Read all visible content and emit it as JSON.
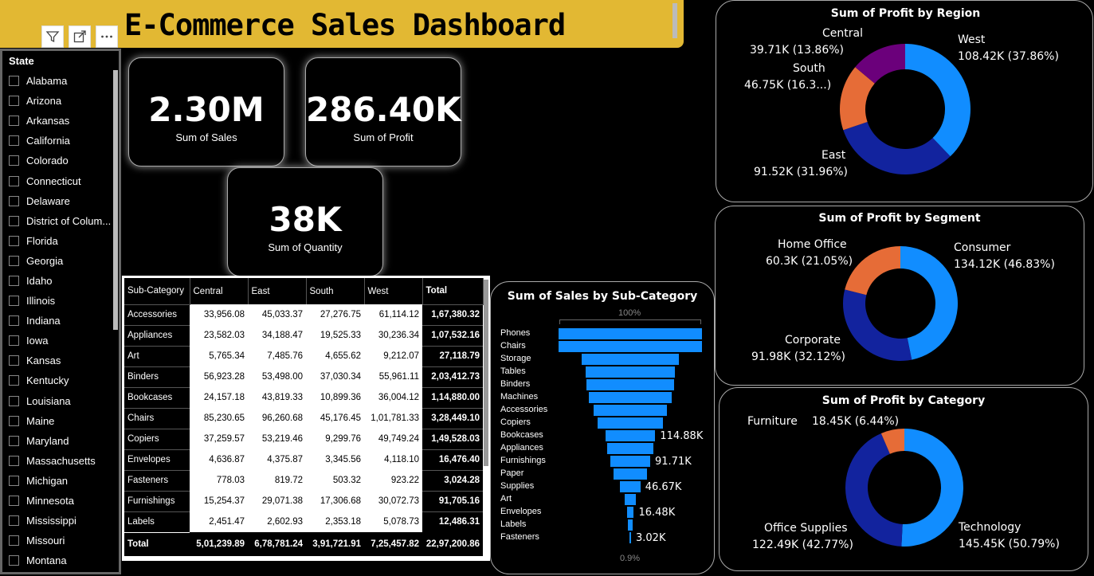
{
  "title": "E-Commerce Sales Dashboard",
  "header_icons": [
    "filter-icon",
    "expand-icon",
    "more-options-icon"
  ],
  "slicer": {
    "title": "State",
    "items": [
      "Alabama",
      "Arizona",
      "Arkansas",
      "California",
      "Colorado",
      "Connecticut",
      "Delaware",
      "District of Colum...",
      "Florida",
      "Georgia",
      "Idaho",
      "Illinois",
      "Indiana",
      "Iowa",
      "Kansas",
      "Kentucky",
      "Louisiana",
      "Maine",
      "Maryland",
      "Massachusetts",
      "Michigan",
      "Minnesota",
      "Mississippi",
      "Missouri",
      "Montana"
    ]
  },
  "kpis": {
    "sales": {
      "value": "2.30M",
      "label": "Sum of Sales"
    },
    "profit": {
      "value": "286.40K",
      "label": "Sum of Profit"
    },
    "quantity": {
      "value": "38K",
      "label": "Sum of Quantity"
    }
  },
  "matrix": {
    "headers": [
      "Sub-Category",
      "Central",
      "East",
      "South",
      "West",
      "Total"
    ],
    "rows": [
      [
        "Accessories",
        "33,956.08",
        "45,033.37",
        "27,276.75",
        "61,114.12",
        "1,67,380.32"
      ],
      [
        "Appliances",
        "23,582.03",
        "34,188.47",
        "19,525.33",
        "30,236.34",
        "1,07,532.16"
      ],
      [
        "Art",
        "5,765.34",
        "7,485.76",
        "4,655.62",
        "9,212.07",
        "27,118.79"
      ],
      [
        "Binders",
        "56,923.28",
        "53,498.00",
        "37,030.34",
        "55,961.11",
        "2,03,412.73"
      ],
      [
        "Bookcases",
        "24,157.18",
        "43,819.33",
        "10,899.36",
        "36,004.12",
        "1,14,880.00"
      ],
      [
        "Chairs",
        "85,230.65",
        "96,260.68",
        "45,176.45",
        "1,01,781.33",
        "3,28,449.10"
      ],
      [
        "Copiers",
        "37,259.57",
        "53,219.46",
        "9,299.76",
        "49,749.24",
        "1,49,528.03"
      ],
      [
        "Envelopes",
        "4,636.87",
        "4,375.87",
        "3,345.56",
        "4,118.10",
        "16,476.40"
      ],
      [
        "Fasteners",
        "778.03",
        "819.72",
        "503.32",
        "923.22",
        "3,024.28"
      ],
      [
        "Furnishings",
        "15,254.37",
        "29,071.38",
        "17,306.68",
        "30,072.73",
        "91,705.16"
      ],
      [
        "Labels",
        "2,451.47",
        "2,602.93",
        "2,353.18",
        "5,078.73",
        "12,486.31"
      ]
    ],
    "total": [
      "Total",
      "5,01,239.89",
      "6,78,781.24",
      "3,91,721.91",
      "7,25,457.82",
      "22,97,200.86"
    ]
  },
  "chart_data": [
    {
      "type": "pie",
      "title": "Sum of Profit by Region",
      "labels": [
        "West",
        "East",
        "South",
        "Central"
      ],
      "values": [
        108.42,
        91.52,
        46.75,
        39.71
      ],
      "percents": [
        37.86,
        31.96,
        16.3,
        13.86
      ],
      "value_labels": [
        "108.42K (37.86%)",
        "91.52K (31.96%)",
        "46.75K (16.3...)",
        "39.71K (13.86%)"
      ],
      "colors": [
        "#118dff",
        "#12239e",
        "#e66c37",
        "#6b007b"
      ]
    },
    {
      "type": "pie",
      "title": "Sum of Profit by Segment",
      "labels": [
        "Consumer",
        "Corporate",
        "Home Office"
      ],
      "values": [
        134.12,
        91.98,
        60.3
      ],
      "percents": [
        46.83,
        32.12,
        21.05
      ],
      "value_labels": [
        "134.12K (46.83%)",
        "91.98K (32.12%)",
        "60.3K (21.05%)"
      ],
      "colors": [
        "#118dff",
        "#12239e",
        "#e66c37"
      ]
    },
    {
      "type": "pie",
      "title": "Sum of Profit by Category",
      "labels": [
        "Technology",
        "Office Supplies",
        "Furniture"
      ],
      "values": [
        145.45,
        122.49,
        18.45
      ],
      "percents": [
        50.79,
        42.77,
        6.44
      ],
      "value_labels": [
        "145.45K (50.79%)",
        "122.49K (42.77%)",
        "18.45K (6.44%)"
      ],
      "colors": [
        "#118dff",
        "#12239e",
        "#e66c37"
      ]
    },
    {
      "type": "bar",
      "title": "Sum of Sales by Sub-Category",
      "top_label": "100%",
      "bottom_label": "0.9%",
      "categories": [
        "Phones",
        "Chairs",
        "Storage",
        "Tables",
        "Binders",
        "Machines",
        "Accessories",
        "Copiers",
        "Bookcases",
        "Appliances",
        "Furnishings",
        "Paper",
        "Supplies",
        "Art",
        "Envelopes",
        "Labels",
        "Fasteners"
      ],
      "values": [
        330.01,
        328.45,
        223.84,
        206.97,
        203.41,
        189.24,
        167.38,
        149.53,
        114.88,
        107.53,
        91.71,
        78.48,
        46.67,
        27.12,
        16.48,
        12.49,
        3.02
      ],
      "data_labels": {
        "Bookcases": "114.88K",
        "Furnishings": "91.71K",
        "Supplies": "46.67K",
        "Envelopes": "16.48K",
        "Fasteners": "3.02K"
      },
      "color": "#118dff"
    }
  ]
}
